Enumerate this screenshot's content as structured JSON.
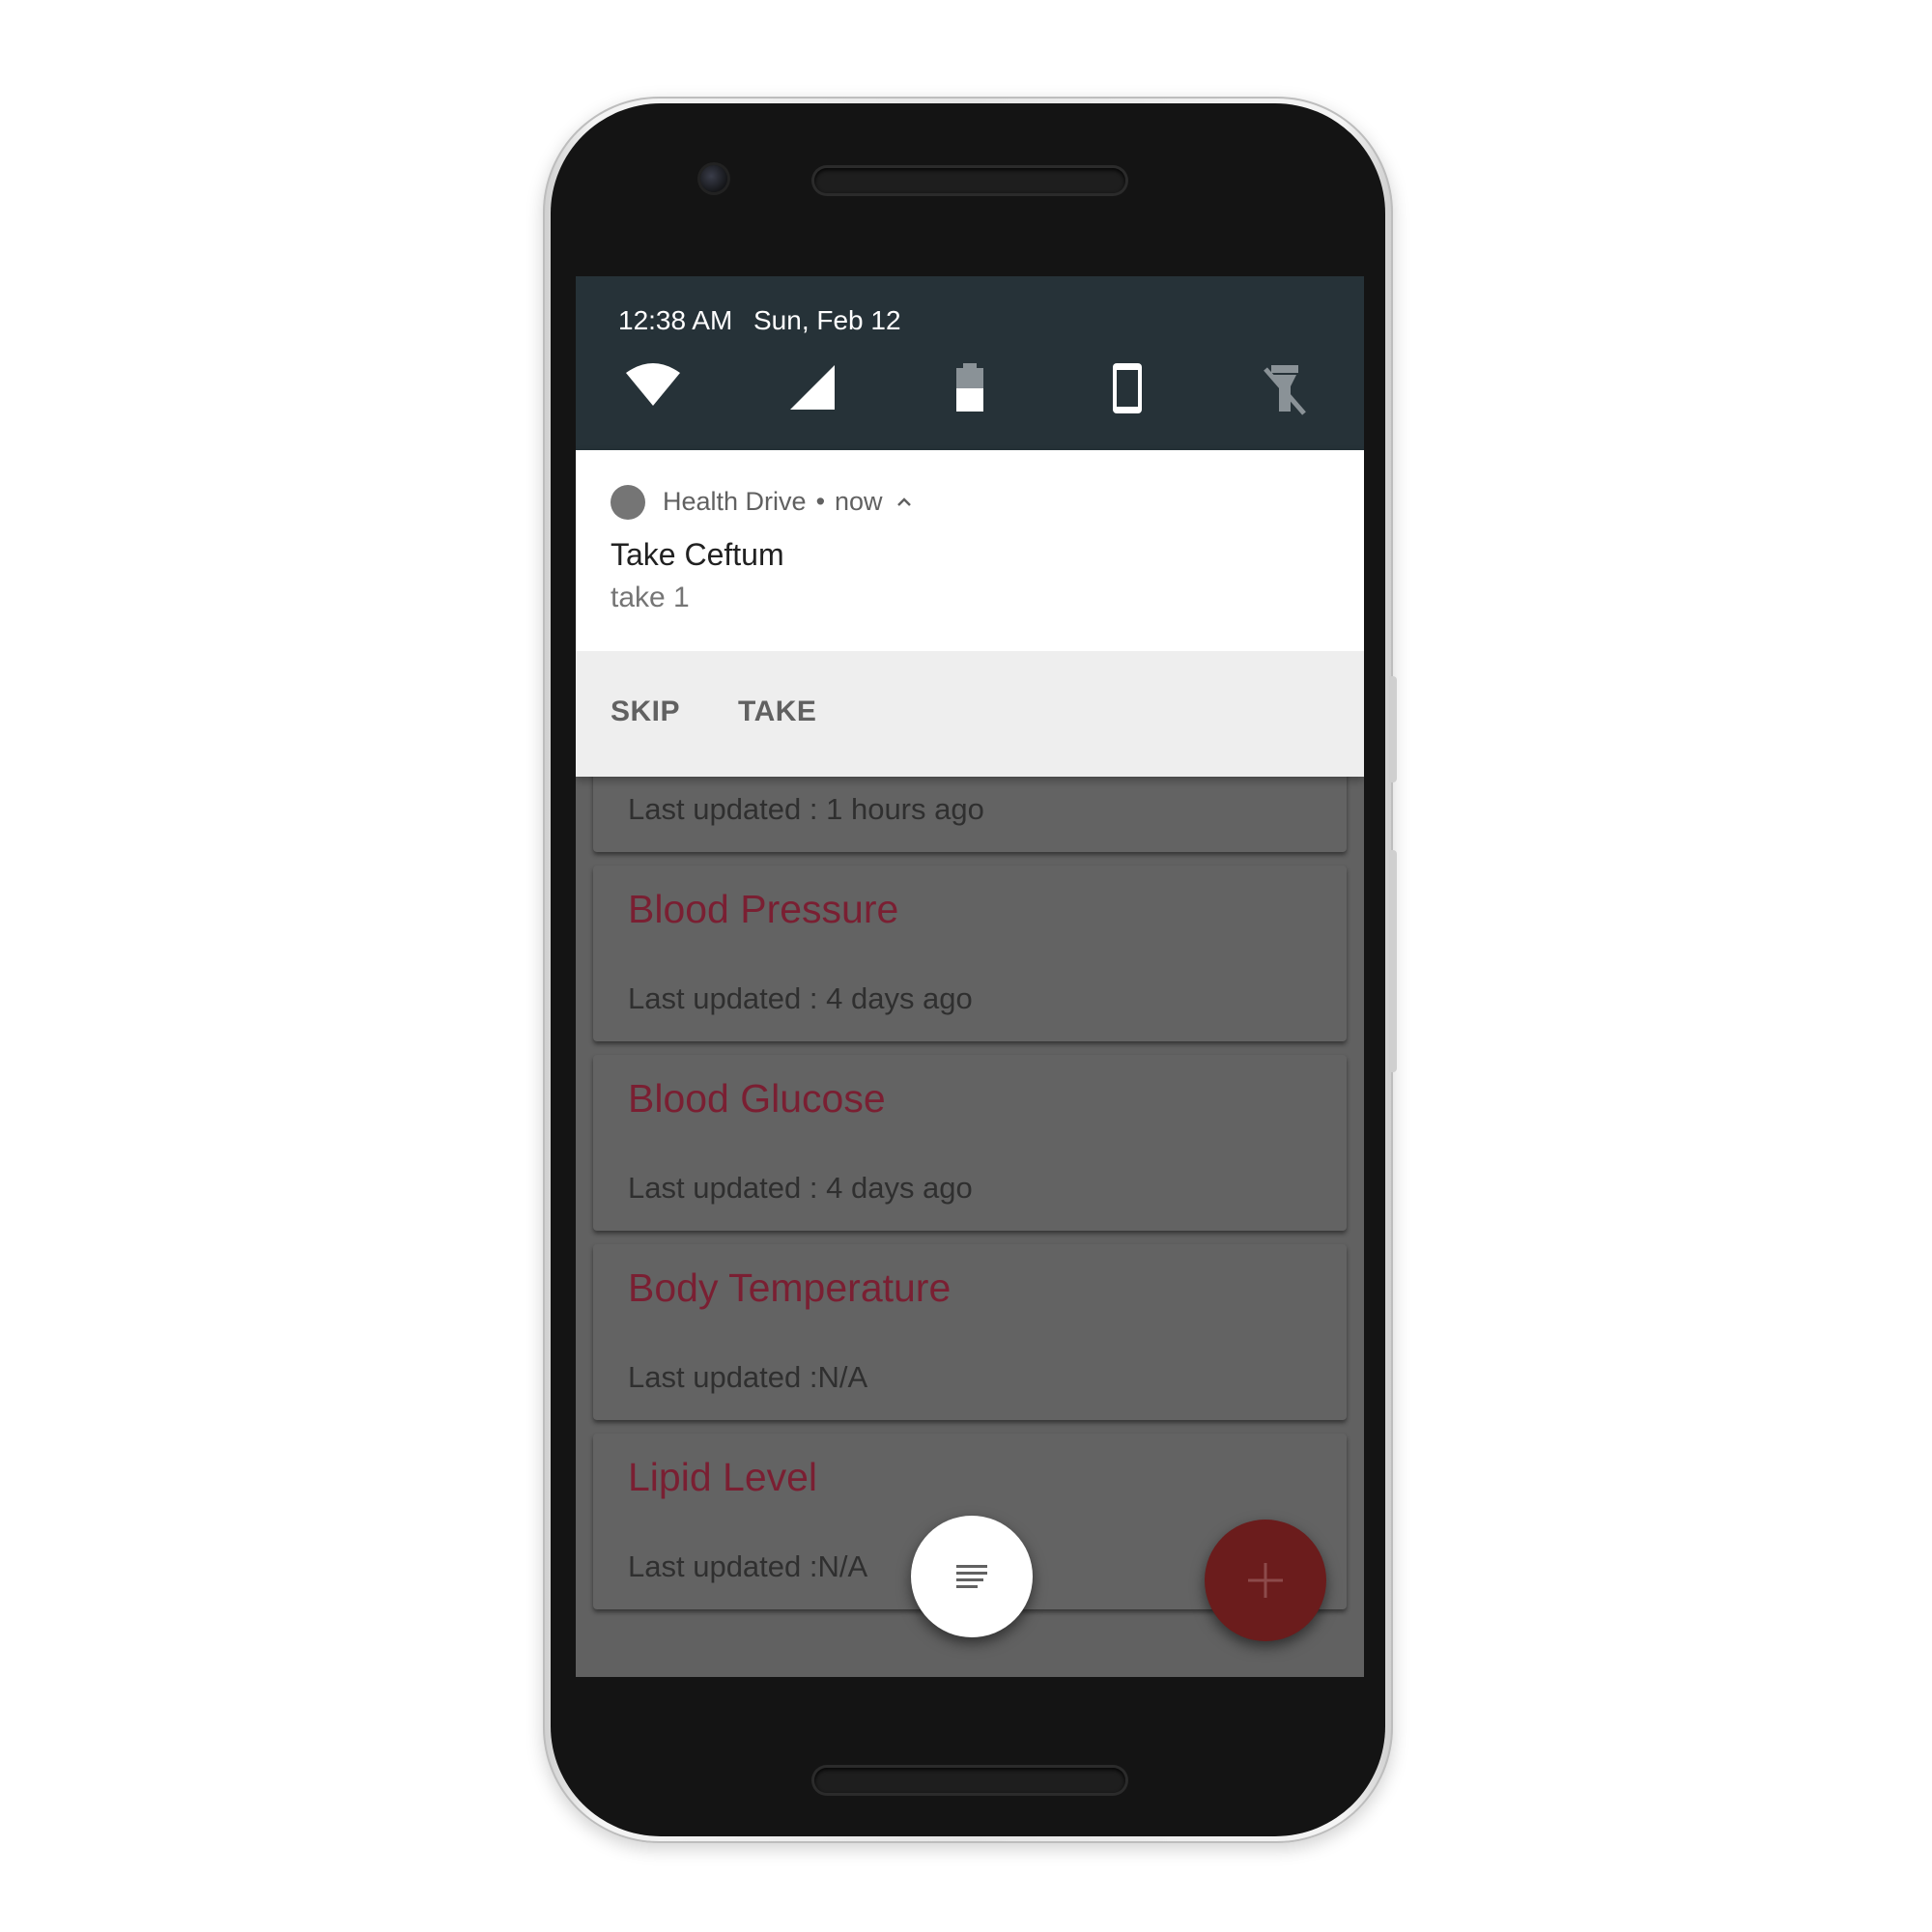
{
  "status": {
    "time": "12:38 AM",
    "date": "Sun, Feb 12",
    "quick_settings_icons": [
      "wifi-icon",
      "cell-signal-icon",
      "battery-icon",
      "phone-icon",
      "flashlight-off-icon"
    ]
  },
  "notification": {
    "app_name": "Health Drive",
    "separator": "•",
    "time": "now",
    "title": "Take Ceftum",
    "text": "take 1",
    "actions": {
      "skip": "SKIP",
      "take": "TAKE"
    }
  },
  "cards": [
    {
      "title": "",
      "subtitle": "Last updated : 1 hours ago"
    },
    {
      "title": "Blood Pressure",
      "subtitle": "Last updated :  4 days ago"
    },
    {
      "title": "Blood Glucose",
      "subtitle": "Last updated :  4 days ago"
    },
    {
      "title": "Body Temperature",
      "subtitle": "Last updated :N/A"
    },
    {
      "title": "Lipid Level",
      "subtitle": "Last updated :N/A"
    }
  ],
  "fabs": {
    "menu_icon": "notes-icon",
    "add_icon": "plus-icon"
  },
  "colors": {
    "status_bar": "#263238",
    "card_title": "#7a1f32",
    "fab_add": "#6b1c1c",
    "scrim_card": "#636363"
  }
}
